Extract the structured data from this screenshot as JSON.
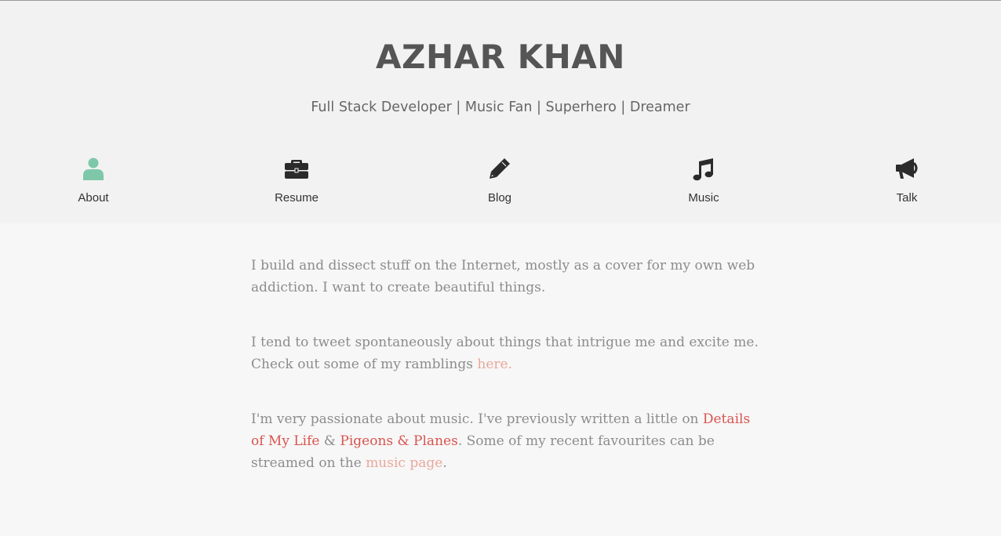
{
  "header": {
    "title": "AZHAR KHAN",
    "tagline": "Full Stack Developer | Music Fan | Superhero | Dreamer"
  },
  "nav": {
    "items": [
      {
        "label": "About",
        "icon": "user-icon",
        "color": "#7ec8a9"
      },
      {
        "label": "Resume",
        "icon": "briefcase-icon",
        "color": "#2b2b2b"
      },
      {
        "label": "Blog",
        "icon": "pencil-icon",
        "color": "#2b2b2b"
      },
      {
        "label": "Music",
        "icon": "music-note-icon",
        "color": "#2b2b2b"
      },
      {
        "label": "Talk",
        "icon": "megaphone-icon",
        "color": "#2b2b2b"
      }
    ]
  },
  "content": {
    "p1": "I build and dissect stuff on the Internet, mostly as a cover for my own web addiction. I want to create beautiful things.",
    "p2_text": "I tend to tweet spontaneously about things that intrigue me and excite me. Check out some of my ramblings ",
    "p2_link": "here.",
    "p3_text1": "I'm very passionate about music. I've previously written a little on ",
    "p3_link1": "Details of My Life",
    "p3_amp": " & ",
    "p3_link2": "Pigeons & Planes",
    "p3_text2": ". Some of my recent favourites can be streamed on the ",
    "p3_link3": "music page",
    "p3_end": "."
  },
  "colors": {
    "accent_active": "#7ec8a9",
    "link_light": "#eaa79a",
    "link_red": "#d9534f"
  }
}
